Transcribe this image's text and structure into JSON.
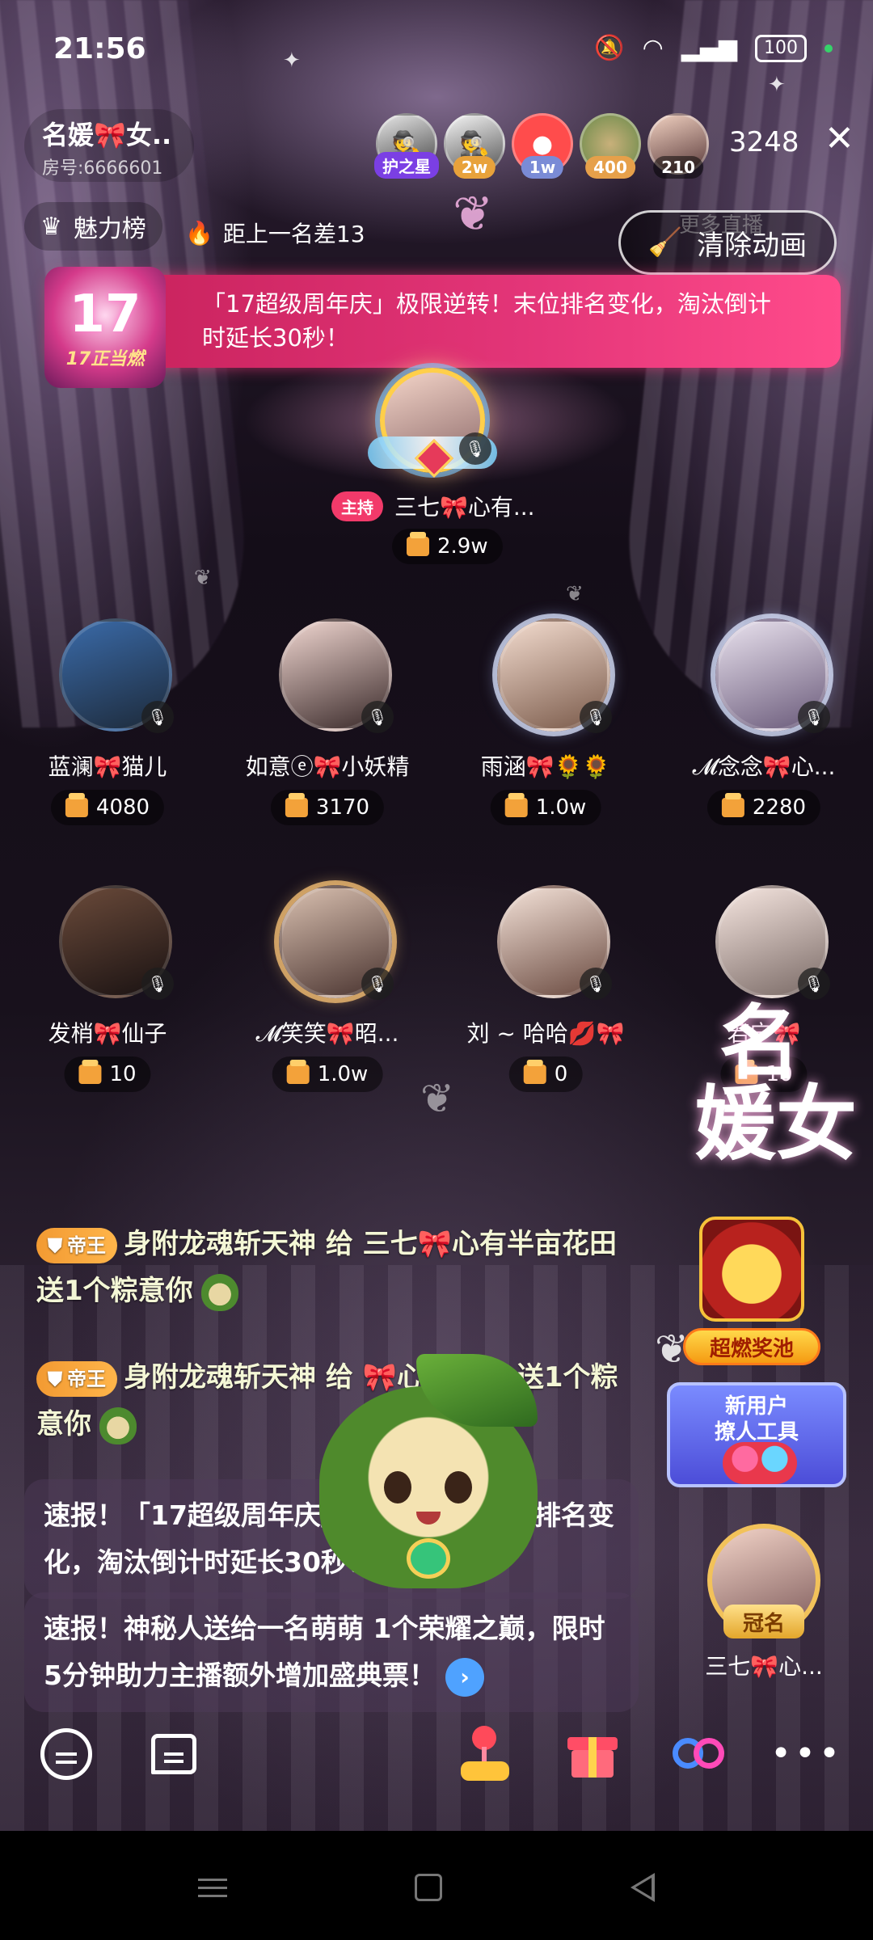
{
  "status_bar": {
    "time": "21:56",
    "battery": "100",
    "icons": [
      "mute-icon",
      "wifi-icon",
      "signal-icon",
      "battery-icon"
    ]
  },
  "room": {
    "name": "名媛🎀女..",
    "id_text": "房号:6666601",
    "viewer_count": "3248",
    "viewers": [
      {
        "badge": "护之星",
        "badge_color": "#7b3fe4",
        "icon": "masked-user-icon"
      },
      {
        "badge": "2w",
        "badge_color": "#e8a23b",
        "icon": "masked-user-icon"
      },
      {
        "badge": "1w",
        "badge_color": "#7a8bd6",
        "icon": "masked-user-icon"
      },
      {
        "badge": "400",
        "badge_color": "#e6a04a",
        "icon": "user-avatar"
      },
      {
        "badge": "210",
        "badge_color": "rgba(0,0,0,0.5)",
        "icon": "user-avatar"
      }
    ]
  },
  "subheader": {
    "charm_label": "魅力榜",
    "rank_gap": "距上一名差13",
    "clear_animation": "清除动画",
    "more_live": "更多直播"
  },
  "banner": {
    "logo_number": "17",
    "logo_sub": "17正当燃",
    "text": "「17超级周年庆」极限逆转！末位排名变化，淘汰倒计时延长30秒！"
  },
  "host": {
    "tag": "主持",
    "name": "三七🎀心有...",
    "score": "2.9w"
  },
  "seats": [
    {
      "name": "蓝澜🎀猫儿",
      "score": "4080"
    },
    {
      "name": "如意ⓔ🎀小妖精",
      "score": "3170"
    },
    {
      "name": "雨涵🎀🌻🌻",
      "score": "1.0w"
    },
    {
      "name": "𝓜念念🎀心...",
      "score": "2280"
    },
    {
      "name": "发梢🎀仙子",
      "score": "10"
    },
    {
      "name": "𝓜笑笑🎀昭...",
      "score": "1.0w"
    },
    {
      "name": "刘 ~ 哈哈💋🎀",
      "score": "0"
    },
    {
      "name": "若宁🎀",
      "score": "10"
    }
  ],
  "chat": [
    {
      "level": "帝王",
      "text": "身附龙魂斩天神 给 三七🎀心有半亩花田 送1个粽意你"
    },
    {
      "level": "帝王",
      "text": "身附龙魂斩天神 给 🎀心心念念 送1个粽意你"
    }
  ],
  "news": [
    {
      "text": "速报！「17超级周年庆」极限逆转！末位排名变化，淘汰倒计时延长30秒！"
    },
    {
      "text": "速报！神秘人送给一名萌萌 1个荣耀之巅，限时5分钟助力主播额外增加盛典票！"
    }
  ],
  "widgets": {
    "brand_line1": "名",
    "brand_line2": "媛女",
    "prize_pool": "超燃奖池",
    "new_user": "新用户",
    "new_user_tool": "撩人工具",
    "crown_tag": "冠名",
    "crown_name": "三七🎀心..."
  },
  "toolbar": {
    "items": [
      "chat-icon",
      "comment-icon",
      "joystick-icon",
      "gift-icon",
      "link-icon",
      "more-icon"
    ]
  }
}
